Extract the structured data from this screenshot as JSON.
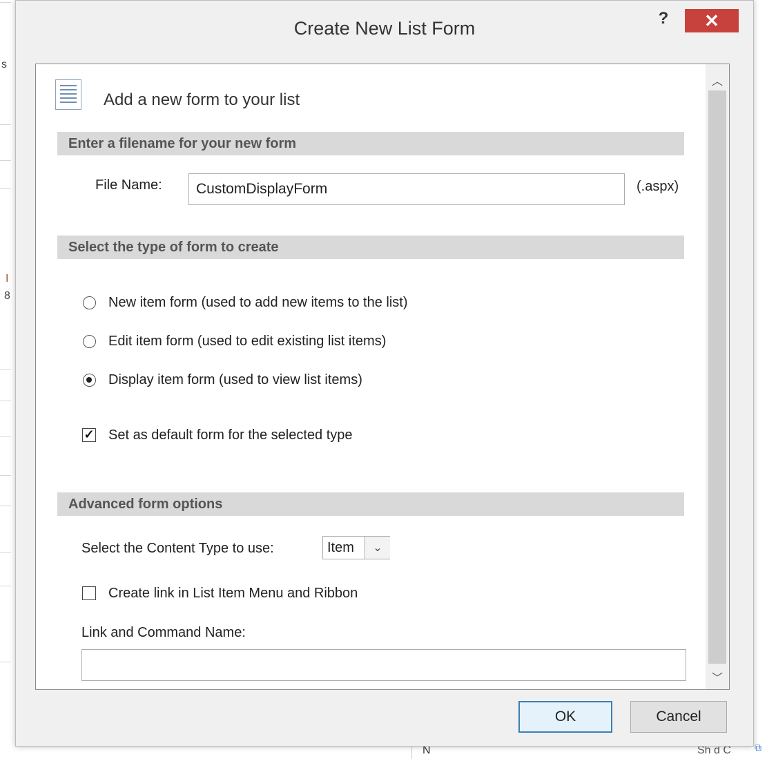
{
  "dialog": {
    "title": "Create New List Form",
    "help_label": "?",
    "close_label": "✕"
  },
  "content": {
    "heading": "Add a new form to your list",
    "filename_section": {
      "title": "Enter a filename for your new form",
      "file_name_label": "File Name:",
      "file_name_value": "CustomDisplayForm",
      "extension": "(.aspx)"
    },
    "type_section": {
      "title": "Select the type of form to create",
      "options": [
        {
          "label": "New item form (used to add new items to the list)",
          "checked": false
        },
        {
          "label": "Edit item form (used to edit existing list items)",
          "checked": false
        },
        {
          "label": "Display item form (used to view list items)",
          "checked": true
        }
      ],
      "default_checkbox": {
        "label": "Set as default form for the selected type",
        "checked": true
      }
    },
    "advanced_section": {
      "title": "Advanced form options",
      "content_type_label": "Select the Content Type to use:",
      "content_type_value": "Item",
      "create_link": {
        "label": "Create link in List Item Menu and Ribbon",
        "checked": false
      },
      "link_name_label": "Link and Command Name:",
      "link_name_value": ""
    }
  },
  "buttons": {
    "ok": "OK",
    "cancel": "Cancel"
  },
  "background": {
    "left_fragments": [
      "s",
      "I",
      "8"
    ],
    "bottom_text": "N",
    "bottom_right_text": "Sh d C"
  },
  "colors": {
    "close_button": "#c7423c",
    "ok_border": "#3c7fb1",
    "section_band": "#d9d9d9"
  },
  "icons": {
    "help": "question-mark",
    "close": "x",
    "heading": "list-form-icon",
    "scroll_up": "chevron-up",
    "scroll_down": "chevron-down",
    "dropdown": "chevron-down",
    "checkbox_check": "check-mark"
  }
}
